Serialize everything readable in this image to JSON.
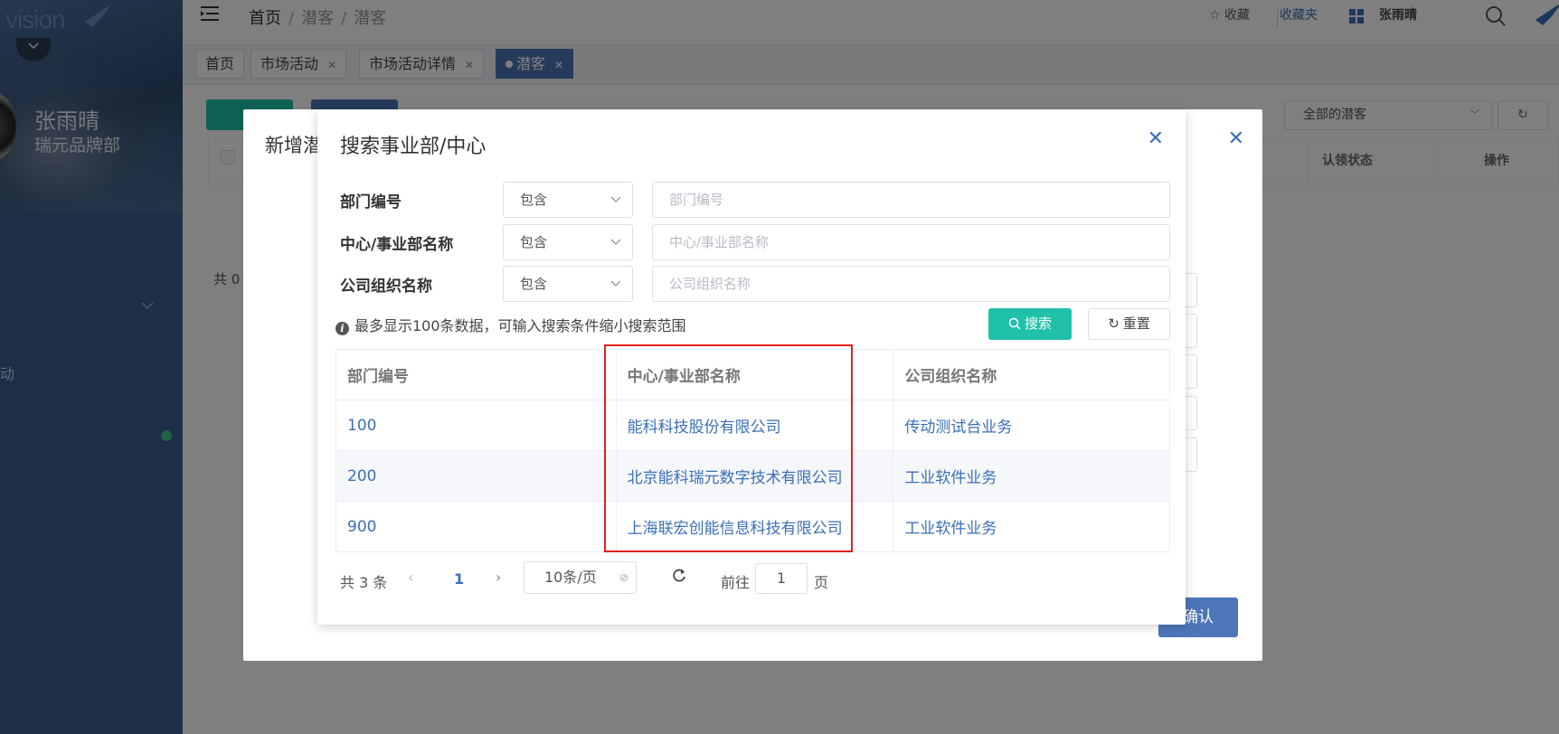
{
  "sidebar": {
    "logo_text": "vision",
    "user_name": "张雨晴",
    "user_dept": "瑞元品牌部",
    "menu_item_partial": "动"
  },
  "topbar": {
    "breadcrumb": [
      "首页",
      "潜客",
      "潜客"
    ],
    "favorite_label": "收藏",
    "favorites_list_label": "收藏夹",
    "user_name": "张雨晴"
  },
  "tabs": [
    {
      "label": "首页",
      "closable": false
    },
    {
      "label": "市场活动",
      "closable": true
    },
    {
      "label": "市场活动详情",
      "closable": true
    },
    {
      "label": "潜客",
      "closable": true,
      "active": true
    }
  ],
  "background_page": {
    "filter_select": "全部的潜客",
    "columns": [
      "认领状态",
      "操作"
    ],
    "total_text": "共 0"
  },
  "outer_dialog": {
    "title": "新增潜",
    "confirm_label": "确认"
  },
  "dialog": {
    "title": "搜索事业部/中心",
    "filters": [
      {
        "label": "部门编号",
        "operator": "包含",
        "placeholder": "部门编号"
      },
      {
        "label": "中心/事业部名称",
        "operator": "包含",
        "placeholder": "中心/事业部名称"
      },
      {
        "label": "公司组织名称",
        "operator": "包含",
        "placeholder": "公司组织名称"
      }
    ],
    "hint": "最多显示100条数据，可输入搜索条件缩小搜索范围",
    "search_label": "搜索",
    "reset_label": "重置",
    "table": {
      "headers": [
        "部门编号",
        "中心/事业部名称",
        "公司组织名称"
      ],
      "rows": [
        [
          "100",
          "能科科技股份有限公司",
          "传动测试台业务"
        ],
        [
          "200",
          "北京能科瑞元数字技术有限公司",
          "工业软件业务"
        ],
        [
          "900",
          "上海联宏创能信息科技有限公司",
          "工业软件业务"
        ]
      ]
    },
    "pagination": {
      "total_text": "共 3 条",
      "current_page": "1",
      "page_size": "10条/页",
      "goto_label": "前往",
      "goto_value": "1",
      "page_suffix": "页"
    }
  },
  "colors": {
    "primary": "#4d76b9",
    "accent_green": "#1fc1a8",
    "link": "#3a6fb8",
    "highlight": "#e02020",
    "sidebar": "#3d5c8f"
  }
}
